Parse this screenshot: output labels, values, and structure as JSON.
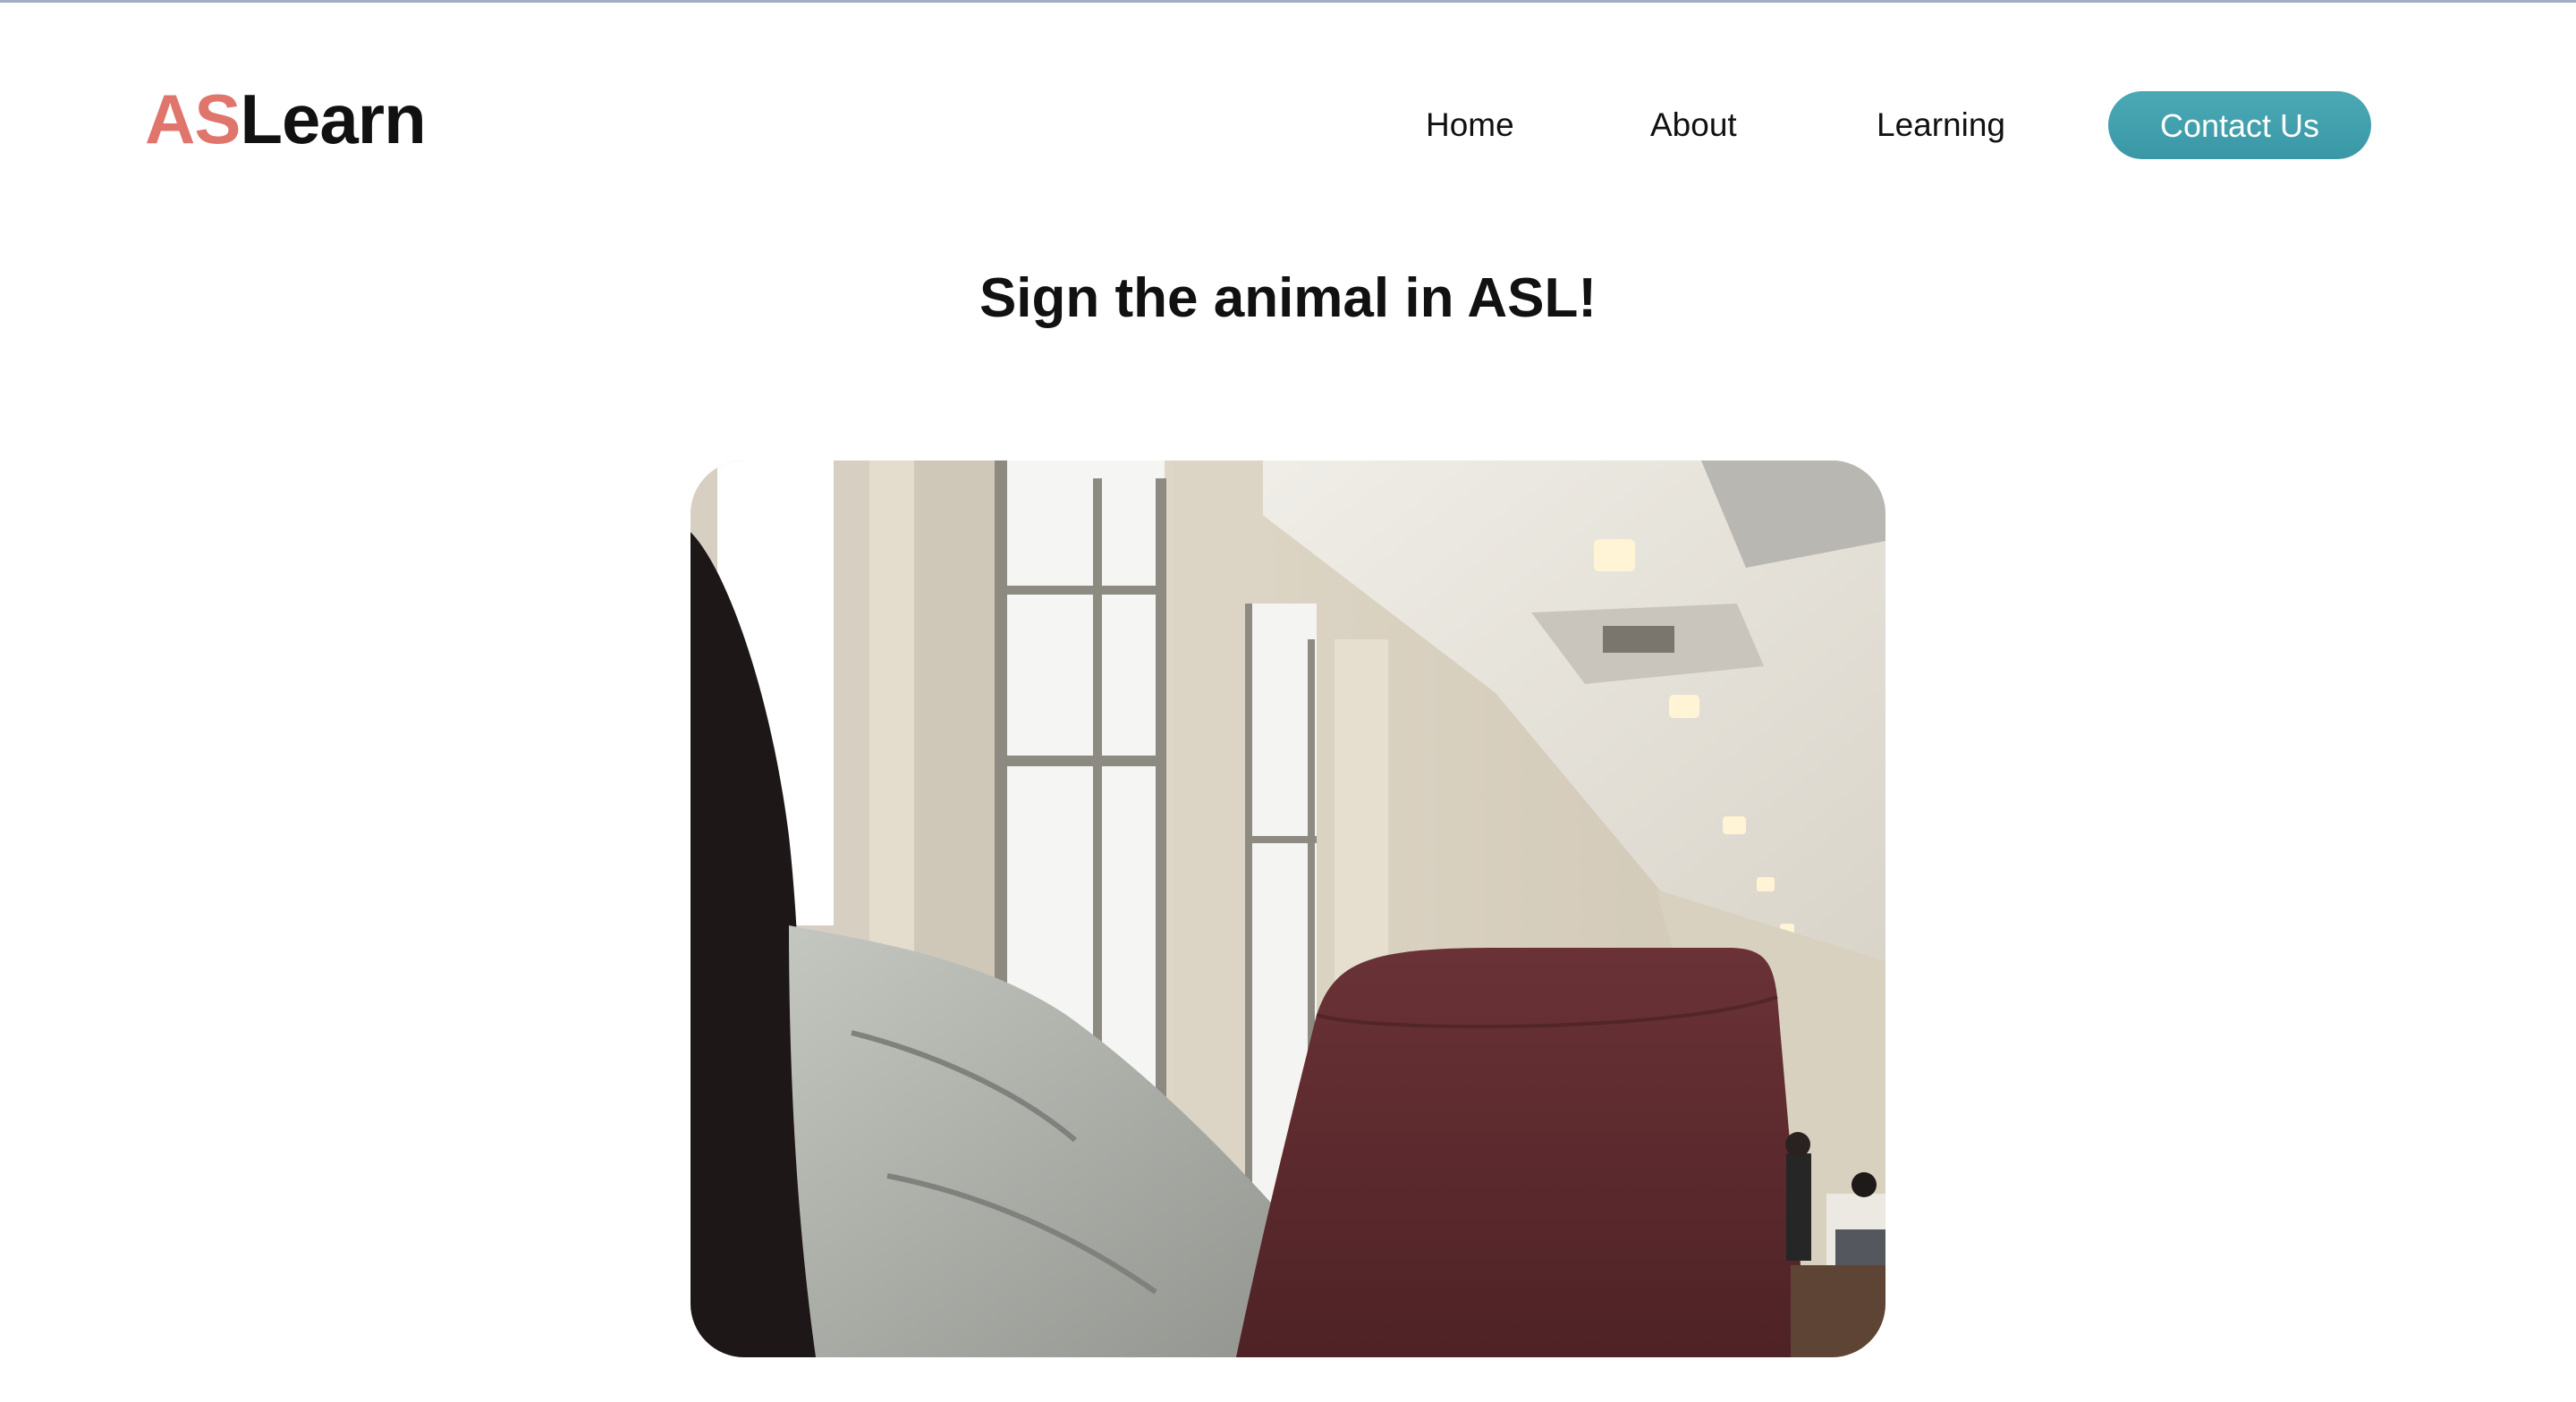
{
  "logo": {
    "accent_text": "AS",
    "main_text": "Learn",
    "accent_color": "#e0756c"
  },
  "nav": {
    "items": [
      {
        "label": "Home"
      },
      {
        "label": "About"
      },
      {
        "label": "Learning"
      }
    ],
    "contact_label": "Contact Us",
    "contact_color": "#44a3b0"
  },
  "main": {
    "heading": "Sign the animal in ASL!",
    "camera_feed": {
      "icon": "webcam-video-feed"
    }
  }
}
